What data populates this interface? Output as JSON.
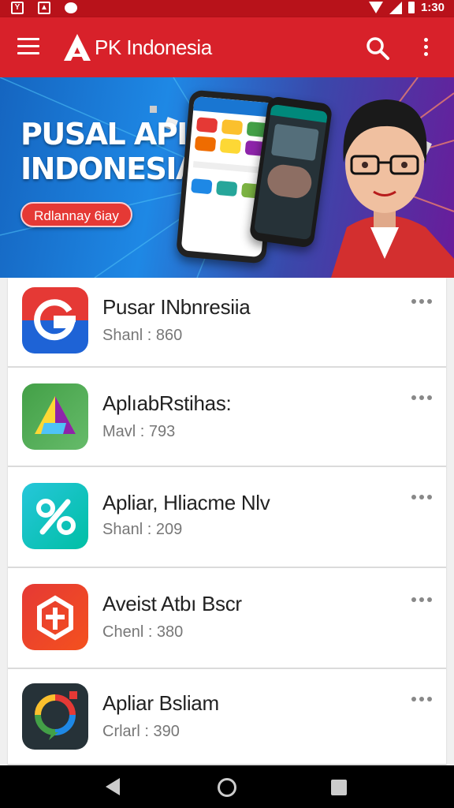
{
  "status_bar": {
    "time": "1:30",
    "battery_level": "high"
  },
  "app_bar": {
    "title": "PK Indonesia",
    "logo_letter": "A",
    "menu_icon": "hamburger-menu-icon",
    "search_icon": "search-icon",
    "more_icon": "more-vert-icon"
  },
  "banner": {
    "headline_line1": "PUSAL API",
    "headline_line2": "INDONESIAI",
    "button_label": "Rdlannay 6iay"
  },
  "apps": [
    {
      "name": "Pusar INbnresiia",
      "sub": "Shanl : 860",
      "icon": "g-logo-icon"
    },
    {
      "name": "AplıabRstihas:",
      "sub": "Mavl : 793",
      "icon": "triangle-logo-icon"
    },
    {
      "name": "Apliar, Hliacme Nlv",
      "sub": "Shanl : 209",
      "icon": "percent-logo-icon"
    },
    {
      "name": "Aveist Atbı Bscr",
      "sub": "Chenl : 380",
      "icon": "box-logo-icon"
    },
    {
      "name": "Apliar Bsliam",
      "sub": "Crlarl : 390",
      "icon": "chat-ring-logo-icon"
    }
  ],
  "colors": {
    "app_bar": "#d8212a",
    "status_bar": "#b8121a",
    "banner_button": "#e53935"
  }
}
